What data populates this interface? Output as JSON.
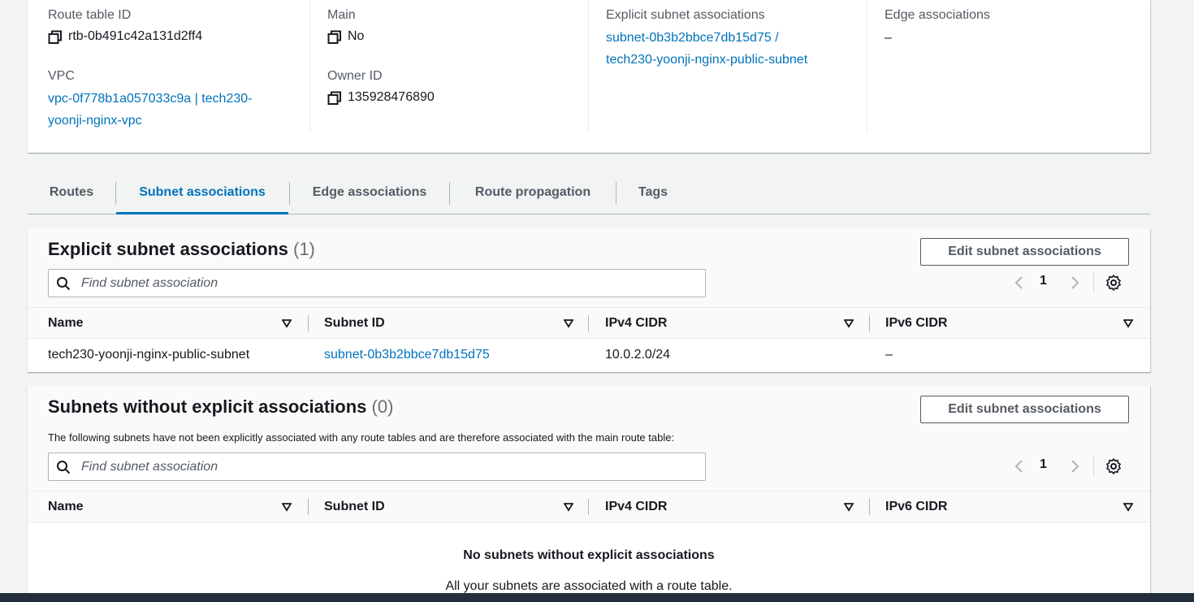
{
  "details": {
    "route_table_id_label": "Route table ID",
    "route_table_id": "rtb-0b491c42a131d2ff4",
    "main_label": "Main",
    "main_value": "No",
    "explicit_label": "Explicit subnet associations",
    "explicit_value_line1": "subnet-0b3b2bbce7db15d75 /",
    "explicit_value_line2": "tech230-yoonji-nginx-public-subnet",
    "edge_label": "Edge associations",
    "edge_value": "–",
    "vpc_label": "VPC",
    "vpc_value_line1": "vpc-0f778b1a057033c9a | tech230-",
    "vpc_value_line2": "yoonji-nginx-vpc",
    "owner_label": "Owner ID",
    "owner_value": "135928476890"
  },
  "tabs": [
    {
      "label": "Routes",
      "active": false
    },
    {
      "label": "Subnet associations",
      "active": true
    },
    {
      "label": "Edge associations",
      "active": false
    },
    {
      "label": "Route propagation",
      "active": false
    },
    {
      "label": "Tags",
      "active": false
    }
  ],
  "explicit_panel": {
    "title": "Explicit subnet associations",
    "count": "(1)",
    "edit_button": "Edit subnet associations",
    "search_placeholder": "Find subnet association",
    "page": "1",
    "columns": [
      "Name",
      "Subnet ID",
      "IPv4 CIDR",
      "IPv6 CIDR"
    ],
    "rows": [
      {
        "name": "tech230-yoonji-nginx-public-subnet",
        "subnet_id": "subnet-0b3b2bbce7db15d75",
        "ipv4": "10.0.2.0/24",
        "ipv6": "–"
      }
    ]
  },
  "implicit_panel": {
    "title": "Subnets without explicit associations",
    "count": "(0)",
    "description": "The following subnets have not been explicitly associated with any route tables and are therefore associated with the main route table:",
    "edit_button": "Edit subnet associations",
    "search_placeholder": "Find subnet association",
    "page": "1",
    "columns": [
      "Name",
      "Subnet ID",
      "IPv4 CIDR",
      "IPv6 CIDR"
    ],
    "empty_title": "No subnets without explicit associations",
    "empty_subtitle": "All your subnets are associated with a route table."
  },
  "colors": {
    "link": "#0073bb",
    "footer": "#232f3e"
  }
}
